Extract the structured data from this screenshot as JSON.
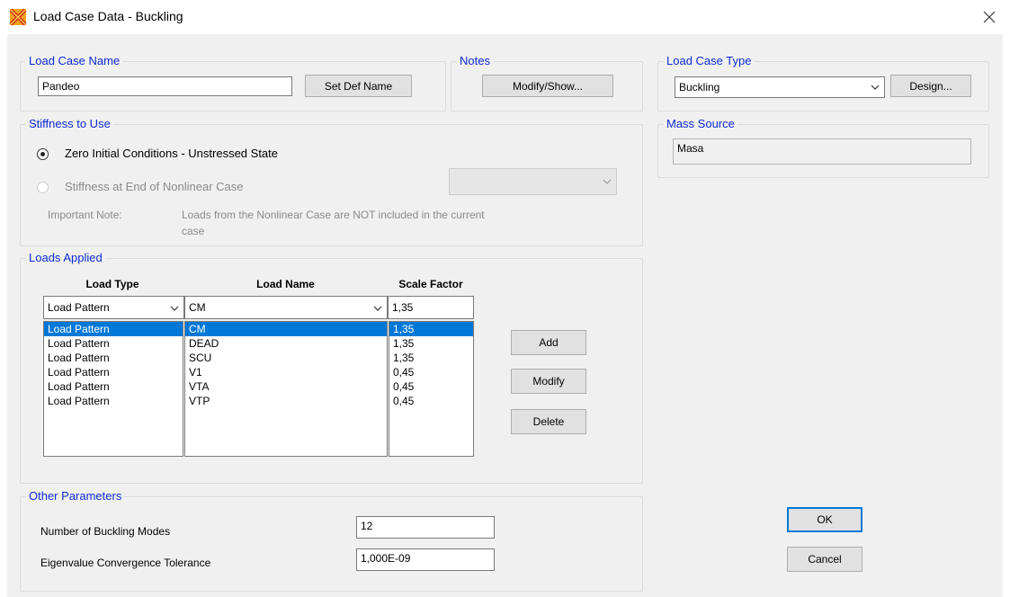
{
  "window": {
    "title": "Load Case Data - Buckling"
  },
  "load_case_name": {
    "group_label": "Load Case Name",
    "value": "Pandeo",
    "set_def_name_label": "Set Def Name"
  },
  "notes": {
    "group_label": "Notes",
    "modify_show_label": "Modify/Show..."
  },
  "load_case_type": {
    "group_label": "Load Case Type",
    "selected": "Buckling",
    "design_label": "Design..."
  },
  "mass_source": {
    "group_label": "Mass Source",
    "value": "Masa"
  },
  "stiffness": {
    "group_label": "Stiffness to Use",
    "option_zero": "Zero Initial Conditions - Unstressed State",
    "option_nonlinear": "Stiffness at End of Nonlinear Case",
    "note_label": "Important Note:",
    "note_line1": "Loads from the Nonlinear Case are NOT included in the current",
    "note_line2": "case"
  },
  "loads_applied": {
    "group_label": "Loads Applied",
    "headers": {
      "load_type": "Load Type",
      "load_name": "Load Name",
      "scale_factor": "Scale Factor"
    },
    "editor": {
      "load_type": "Load Pattern",
      "load_name": "CM",
      "scale_factor": "1,35"
    },
    "rows": [
      {
        "load_type": "Load Pattern",
        "load_name": "CM",
        "scale_factor": "1,35"
      },
      {
        "load_type": "Load Pattern",
        "load_name": "DEAD",
        "scale_factor": "1,35"
      },
      {
        "load_type": "Load Pattern",
        "load_name": "SCU",
        "scale_factor": "1,35"
      },
      {
        "load_type": "Load Pattern",
        "load_name": "V1",
        "scale_factor": "0,45"
      },
      {
        "load_type": "Load Pattern",
        "load_name": "VTA",
        "scale_factor": "0,45"
      },
      {
        "load_type": "Load Pattern",
        "load_name": "VTP",
        "scale_factor": "0,45"
      }
    ],
    "add_label": "Add",
    "modify_label": "Modify",
    "delete_label": "Delete"
  },
  "other_parameters": {
    "group_label": "Other Parameters",
    "modes_label": "Number of Buckling Modes",
    "modes_value": "12",
    "tolerance_label": "Eigenvalue Convergence Tolerance",
    "tolerance_value": "1,000E-09"
  },
  "buttons": {
    "ok_label": "OK",
    "cancel_label": "Cancel"
  },
  "icons": {
    "app": "etabs-app-icon",
    "close": "close-icon",
    "dropdown": "chevron-down-icon"
  },
  "colors": {
    "group_label": "#0d2bd1",
    "selection": "#0078d7",
    "dialog_bg": "#f0f0f0"
  }
}
